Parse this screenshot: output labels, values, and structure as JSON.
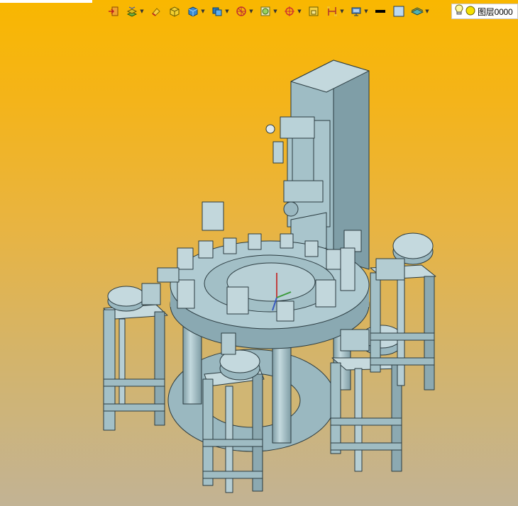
{
  "viewport": {
    "background_top": "#f9b700",
    "background_bottom": "#c2b394",
    "model_color": "#a8c4cc"
  },
  "toolbar": {
    "icons": [
      "exit-icon",
      "layer-manager-icon",
      "eraser-icon",
      "shaded-box-icon",
      "solid-cube-icon",
      "display-style-icon",
      "view-orient-icon",
      "zoom-fit-icon",
      "snap-point-icon",
      "frame-icon",
      "section-icon",
      "render-settings-icon",
      "line-color-icon",
      "face-color-icon",
      "layer-plane-icon"
    ]
  },
  "layer": {
    "current_layer": "图层0000",
    "bulb_icon": "light-bulb-icon",
    "color_swatch": "#f5e000"
  }
}
